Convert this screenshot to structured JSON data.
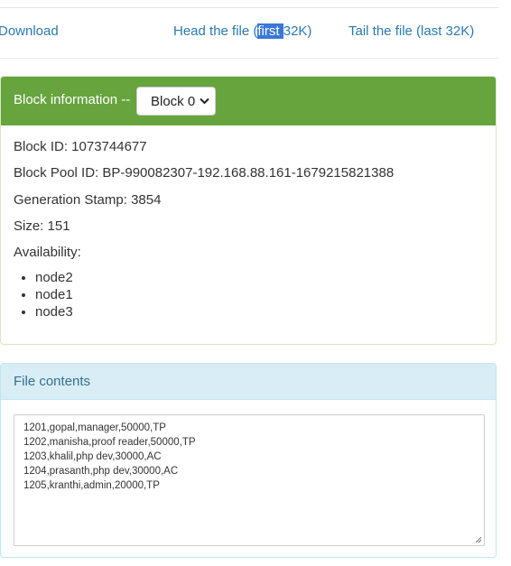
{
  "links": {
    "download": "Download",
    "head_pre": "Head the file (",
    "head_sel": "first ",
    "head_post": "32K)",
    "tail": "Tail the file (last 32K)"
  },
  "block_panel": {
    "title": "Block information --",
    "selected_block": "Block 0",
    "block_id": "Block ID: 1073744677",
    "block_pool_id": "Block Pool ID: BP-990082307-192.168.88.161-1679215821388",
    "generation_stamp": "Generation Stamp: 3854",
    "size": "Size: 151",
    "availability_label": "Availability:",
    "nodes": [
      "node2",
      "node1",
      "node3"
    ]
  },
  "file_contents": {
    "title": "File contents",
    "lines": [
      "1201,gopal,manager,50000,TP",
      "1202,manisha,proof reader,50000,TP",
      "1203,khalil,php dev,30000,AC",
      "1204,prasanth,php dev,30000,AC",
      "1205,kranthi,admin,20000,TP"
    ]
  },
  "colors": {
    "link": "#2a7ab0",
    "success_heading": "#67a43e",
    "info_heading_bg": "#d9edf7",
    "info_heading_text": "#31708f",
    "selection": "#3a78d8"
  }
}
